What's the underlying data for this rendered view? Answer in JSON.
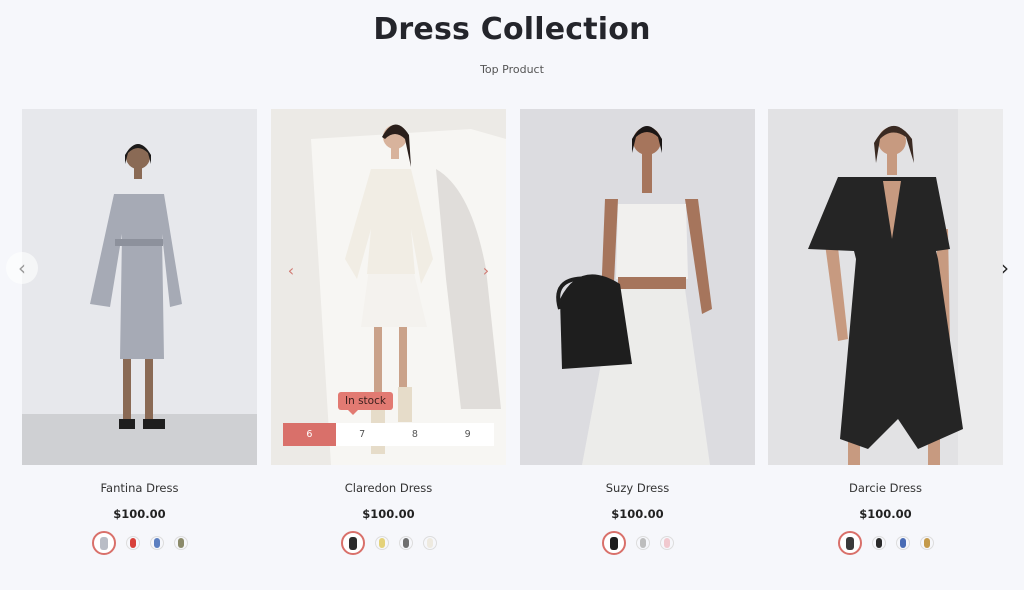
{
  "header": {
    "title": "Dress Collection",
    "subtitle": "Top Product"
  },
  "navigation": {
    "prev_icon": "chevron-left-icon",
    "next_icon": "chevron-right-icon"
  },
  "products": [
    {
      "name": "Fantina Dress",
      "price": "$100.00",
      "swatches": [
        "#b9bdc6",
        "#d8403a",
        "#5c7fc0",
        "#8b8a6a"
      ]
    },
    {
      "name": "Claredon Dress",
      "price": "$100.00",
      "stock_label": "In stock",
      "sizes": [
        "6",
        "7",
        "8",
        "9"
      ],
      "swatches": [
        "#2b2b2b",
        "#e4d27a",
        "#6f6f6f",
        "#eeeae0"
      ]
    },
    {
      "name": "Suzy Dress",
      "price": "$100.00",
      "swatches": [
        "#1d1d1d",
        "#bdbdbd",
        "#f1c9cf"
      ]
    },
    {
      "name": "Darcie Dress",
      "price": "$100.00",
      "swatches": [
        "#3a3a3a",
        "#2a2a2a",
        "#4a6cb5",
        "#c49a4a"
      ]
    }
  ],
  "colors": {
    "accent": "#d9706a",
    "background": "#f6f7fb",
    "heading": "#24252b"
  }
}
